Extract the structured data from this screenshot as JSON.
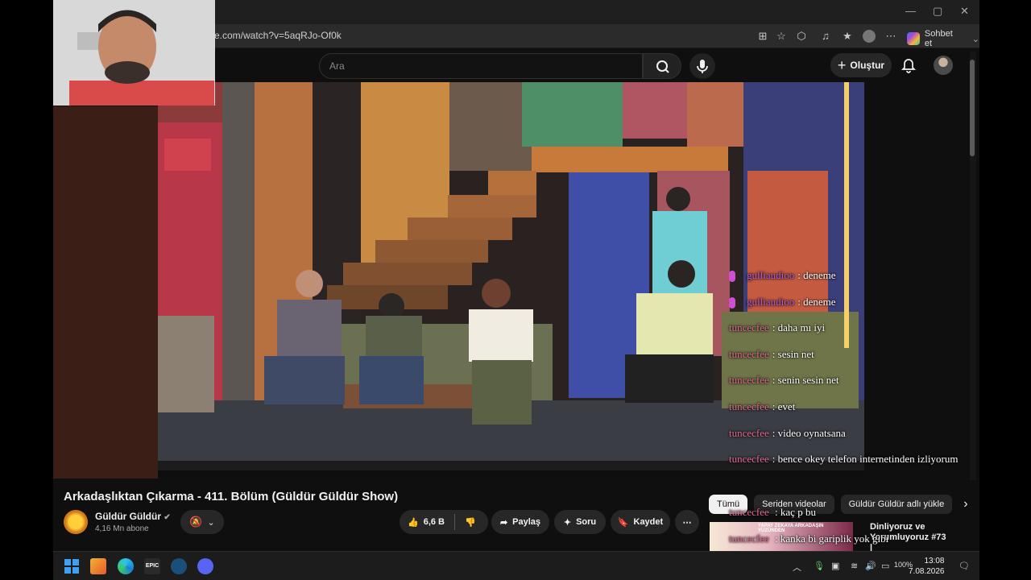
{
  "browser": {
    "url": "e.com/watch?v=5aqRJo-Of0k",
    "copilot_label": "Sohbet et",
    "window_controls": [
      "—",
      "▢",
      "✕"
    ]
  },
  "youtube": {
    "search_placeholder": "Ara",
    "create_label": "Oluştur"
  },
  "chat": [
    {
      "user": "gulliaudioo",
      "text": ": deneme",
      "badge": true,
      "color": "purple"
    },
    {
      "user": "gulliaudioo",
      "text": ": deneme",
      "badge": true,
      "color": "purple"
    },
    {
      "user": "tuncecfee",
      "text": ": daha mı iyi",
      "badge": false
    },
    {
      "user": "tuncecfee",
      "text": ": sesin net",
      "badge": false
    },
    {
      "user": "tuncecfee",
      "text": ": senin sesin net",
      "badge": false
    },
    {
      "user": "tuncecfee",
      "text": ": evet",
      "badge": false
    },
    {
      "user": "tuncecfee",
      "text": ": video oynatsana",
      "badge": false
    },
    {
      "user": "tuncecfee",
      "text": ": bence okey telefon internetinden izliyorum",
      "badge": false
    }
  ],
  "chat_overflow": [
    {
      "user": "tuncecfee",
      "text": ": kaç p bu"
    },
    {
      "user": "tuncecfee",
      "text": ": kanka bi gariplik yok gibi"
    }
  ],
  "video": {
    "title": "Arkadaşlıktan Çıkarma - 411. Bölüm (Güldür Güldür Show)",
    "channel": "Güldür Güldür",
    "subscribers": "4,16 Mn abone",
    "likes": "6,6 B",
    "share_label": "Paylaş",
    "ask_label": "Soru",
    "save_label": "Kaydet",
    "more_label": "⋯"
  },
  "chips": [
    "Tümü",
    "Seriden videolar",
    "Güldür Güldür adlı yükle"
  ],
  "recommendation": {
    "title": "Dinliyoruz ve Yorumluyoruz #73 |",
    "thumb_text": "YAPAY ZEKAYA ARKADAŞIN YÜZÜNDEN"
  },
  "taskbar": {
    "battery": "100%",
    "time": "13:08",
    "date": "7.08.2026"
  },
  "colors": {
    "youtube_bg": "#0f0f0f",
    "chat_user": "#e06b92",
    "chat_user_purple": "#b35bd4"
  }
}
